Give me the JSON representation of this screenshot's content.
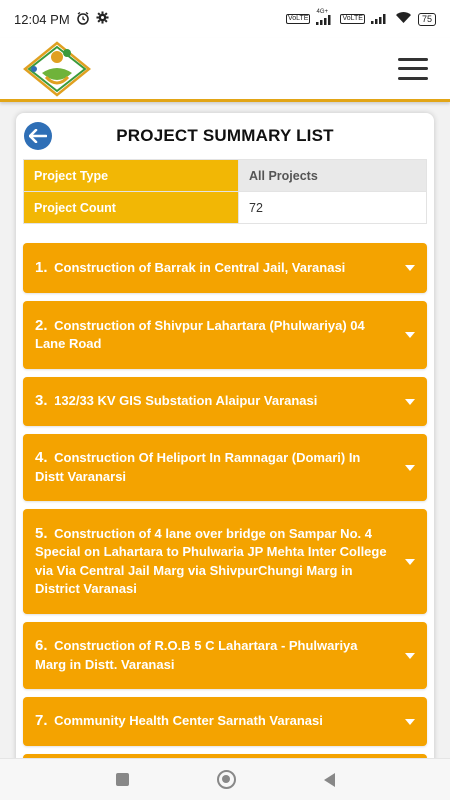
{
  "status": {
    "time": "12:04 PM",
    "alarm_icon": "alarm-icon",
    "settings_icon": "gear-icon",
    "net1": "VoLTE",
    "net2": "4G+",
    "net3": "VoLTE",
    "battery": "75"
  },
  "header": {
    "logo_icon": "logo-icon",
    "menu_icon": "hamburger-menu-icon"
  },
  "card": {
    "title": "PROJECT SUMMARY LIST",
    "back_icon": "back-arrow-icon"
  },
  "summary": [
    {
      "label": "Project Type",
      "value": "All Projects"
    },
    {
      "label": "Project Count",
      "value": "72"
    }
  ],
  "projects": [
    {
      "num": "1.",
      "title": "Construction of Barrak in Central Jail, Varanasi"
    },
    {
      "num": "2.",
      "title": "Construction of Shivpur Lahartara (Phulwariya) 04 Lane Road"
    },
    {
      "num": "3.",
      "title": "132/33 KV GIS Substation Alaipur Varanasi"
    },
    {
      "num": "4.",
      "title": "Construction Of Heliport In Ramnagar (Domari) In Distt Varanarsi"
    },
    {
      "num": "5.",
      "title": "Construction of 4 lane over bridge on Sampar No. 4 Special on Lahartara to Phulwaria JP Mehta Inter College via Via Central Jail Marg via ShivpurChungi Marg in District Varanasi"
    },
    {
      "num": "6.",
      "title": "Construction of R.O.B 5 C Lahartara - Phulwariya Marg in Distt. Varanasi"
    },
    {
      "num": "7.",
      "title": "Community Health Center Sarnath Varanasi"
    }
  ],
  "colors": {
    "accent": "#f4a300",
    "label_bg": "#f2b705",
    "back_button": "#2f6fb6"
  }
}
